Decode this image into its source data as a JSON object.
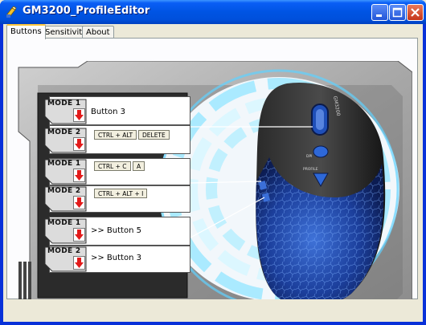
{
  "window": {
    "title": "GM3200_ProfileEditor"
  },
  "tabs": [
    {
      "label": "Buttons",
      "active": true
    },
    {
      "label": "Sensitivity",
      "active": false
    },
    {
      "label": "About",
      "active": false
    }
  ],
  "rows": [
    {
      "mode": "MODE 1",
      "text": "Button 3",
      "keys": []
    },
    {
      "mode": "MODE 2",
      "text": "",
      "keys": [
        "CTRL + ALT",
        "DELETE"
      ]
    },
    {
      "mode": "MODE 1",
      "text": "",
      "keys": [
        "CTRL + C",
        "A"
      ]
    },
    {
      "mode": "MODE 2",
      "text": "",
      "keys": [
        "CTRL + ALT + I"
      ]
    },
    {
      "mode": "MODE 1",
      "text": ">> Button 5",
      "keys": []
    },
    {
      "mode": "MODE 2",
      "text": ">> Button 3",
      "keys": []
    }
  ],
  "mouse": {
    "brand_text": "GM3200",
    "dpi_label": "DPI",
    "profile_label": "PROFILE"
  },
  "colors": {
    "accent_red": "#e21b1b",
    "glow": "#7fdfff",
    "mouse_blue": "#1f4fb8"
  }
}
